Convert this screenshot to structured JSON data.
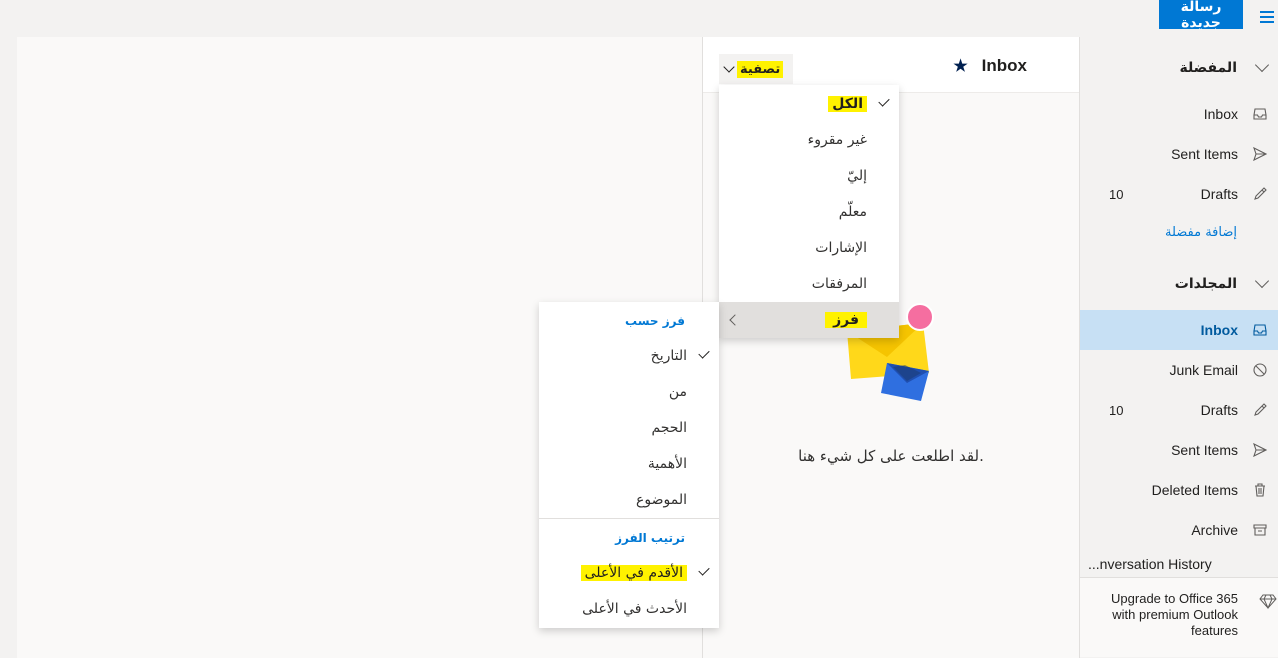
{
  "topbar": {
    "new_message_label": "رسالة جديدة",
    "menu_icon": "hamburger-icon",
    "accent_color": "#0078d4"
  },
  "list": {
    "title": "Inbox",
    "filter_label": "تصفية",
    "empty_message": "لقد اطلعت على كل شيء هنا."
  },
  "filter_menu": {
    "items": [
      {
        "label": "الكل",
        "checked": true
      },
      {
        "label": "غير مقروء"
      },
      {
        "label": "إليّ"
      },
      {
        "label": "معلّم"
      },
      {
        "label": "الإشارات"
      },
      {
        "label": "المرفقات"
      }
    ],
    "sort_label": "فرز"
  },
  "sort_menu": {
    "sort_by_header": "فرز حسب",
    "sort_by": [
      {
        "label": "التاريخ",
        "checked": true
      },
      {
        "label": "من"
      },
      {
        "label": "الحجم"
      },
      {
        "label": "الأهمية"
      },
      {
        "label": "الموضوع"
      }
    ],
    "order_header": "ترتيب الفرز",
    "order": [
      {
        "label": "الأقدم في الأعلى",
        "checked": true
      },
      {
        "label": "الأحدث في الأعلى"
      }
    ]
  },
  "folders": {
    "favorites_header": "المفضلة",
    "favorites": [
      {
        "name": "Inbox",
        "icon": "inbox-icon"
      },
      {
        "name": "Sent Items",
        "icon": "send-icon"
      },
      {
        "name": "Drafts",
        "icon": "pencil-icon",
        "count": "10"
      }
    ],
    "add_favorite": "إضافة مفضلة",
    "folders_header": "المجلدات",
    "items": [
      {
        "name": "Inbox",
        "icon": "inbox-icon",
        "selected": true
      },
      {
        "name": "Junk Email",
        "icon": "block-icon"
      },
      {
        "name": "Drafts",
        "icon": "pencil-icon",
        "count": "10"
      },
      {
        "name": "Sent Items",
        "icon": "send-icon"
      },
      {
        "name": "Deleted Items",
        "icon": "trash-icon"
      },
      {
        "name": "Archive",
        "icon": "archive-icon"
      },
      {
        "name": "...nversation History"
      }
    ],
    "upgrade_text": "Upgrade to Office 365 with premium Outlook features",
    "upgrade_icon": "diamond-icon"
  }
}
